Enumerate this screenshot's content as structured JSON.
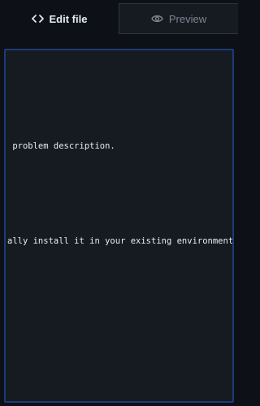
{
  "tabs": {
    "edit": {
      "label": "Edit file",
      "icon": "code-icon"
    },
    "preview": {
      "label": "Preview",
      "icon": "eye-icon"
    }
  },
  "editor": {
    "lines": [
      " problem description.",
      "ally install it in your existing environment."
    ]
  },
  "colors": {
    "background": "#0d1117",
    "editor_bg": "#161b22",
    "editor_border": "#1f3a78",
    "active_text": "#e6edf3",
    "inactive_text": "#7d8590"
  }
}
